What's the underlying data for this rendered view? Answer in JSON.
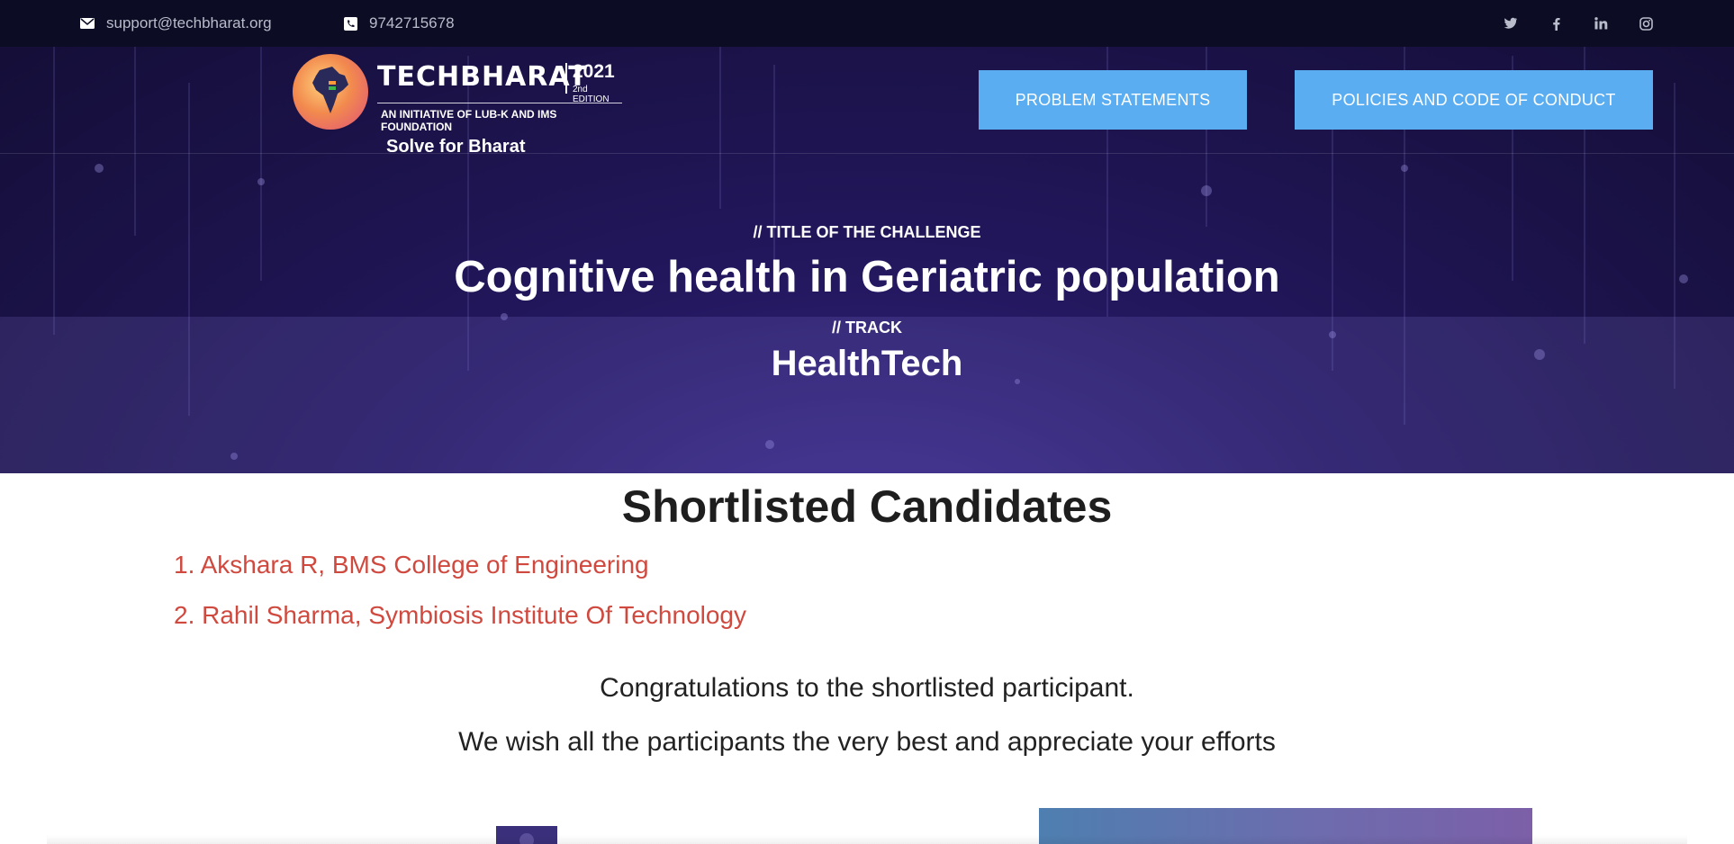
{
  "topbar": {
    "email": "support@techbharat.org",
    "phone": "9742715678",
    "email_icon": "envelope-icon",
    "phone_icon": "phone-icon",
    "social_icons": [
      "twitter-icon",
      "facebook-icon",
      "linkedin-icon",
      "instagram-icon"
    ]
  },
  "brand": {
    "name": "TECHBHARAT",
    "year": "2021",
    "edition": "2nd EDITION",
    "tagline": "AN INITIATIVE OF LUB-K AND IMS FOUNDATION",
    "slogan": "Solve for Bharat"
  },
  "nav": {
    "problem_statements": "PROBLEM STATEMENTS",
    "policies": "POLICIES AND CODE OF CONDUCT"
  },
  "hero": {
    "challenge_kicker": "// TITLE OF THE CHALLENGE",
    "challenge_title": "Cognitive health in Geriatric population",
    "track_kicker": "// TRACK",
    "track": "HealthTech"
  },
  "shortlist": {
    "heading": "Shortlisted Candidates",
    "candidates": [
      "1. Akshara R, BMS College of Engineering",
      "2. Rahil Sharma, Symbiosis Institute Of Technology"
    ],
    "congrats": "Congratulations to the shortlisted participant.",
    "wishes": "We wish all the participants the very best and appreciate your efforts"
  },
  "colors": {
    "topbar_bg": "#0c0c24",
    "hero_bg": "#1a1246",
    "nav_button": "#5aadf0",
    "candidate_text": "#d0493f"
  }
}
